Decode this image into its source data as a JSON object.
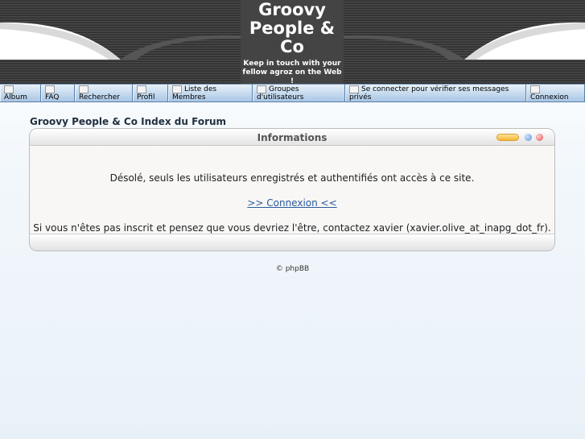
{
  "header": {
    "title": "Groovy People & Co",
    "description": "Keep in touch with your fellow agroz on the Web !"
  },
  "nav": {
    "items": [
      {
        "label": "Album",
        "icon": "album-icon"
      },
      {
        "label": "FAQ",
        "icon": "faq-icon"
      },
      {
        "label": "Rechercher",
        "icon": "search-icon"
      },
      {
        "label": "Profil",
        "icon": "profile-icon"
      },
      {
        "label": "Liste des Membres",
        "icon": "members-icon"
      },
      {
        "label": "Groupes d'utilisateurs",
        "icon": "groups-icon"
      },
      {
        "label": "Se connecter pour vérifier ses messages privés",
        "icon": "messages-icon"
      },
      {
        "label": "Connexion",
        "icon": "login-icon"
      }
    ]
  },
  "main": {
    "forum_index": "Groovy People & Co Index du Forum",
    "panel_title": "Informations",
    "message": "Désolé, seuls les utilisateurs enregistrés et authentifiés ont accès à ce site.",
    "login_link": ">> Connexion <<",
    "contact": "Si vous n'êtes pas inscrit et pensez que vous devriez l'être, contactez xavier (xavier.olive_at_inapg_dot_fr)."
  },
  "footer": {
    "credit": "© phpBB"
  },
  "colors": {
    "header_bg": "#3a3a3a",
    "nav_bg": "#a8c6e5",
    "link": "#2a5a9a"
  }
}
